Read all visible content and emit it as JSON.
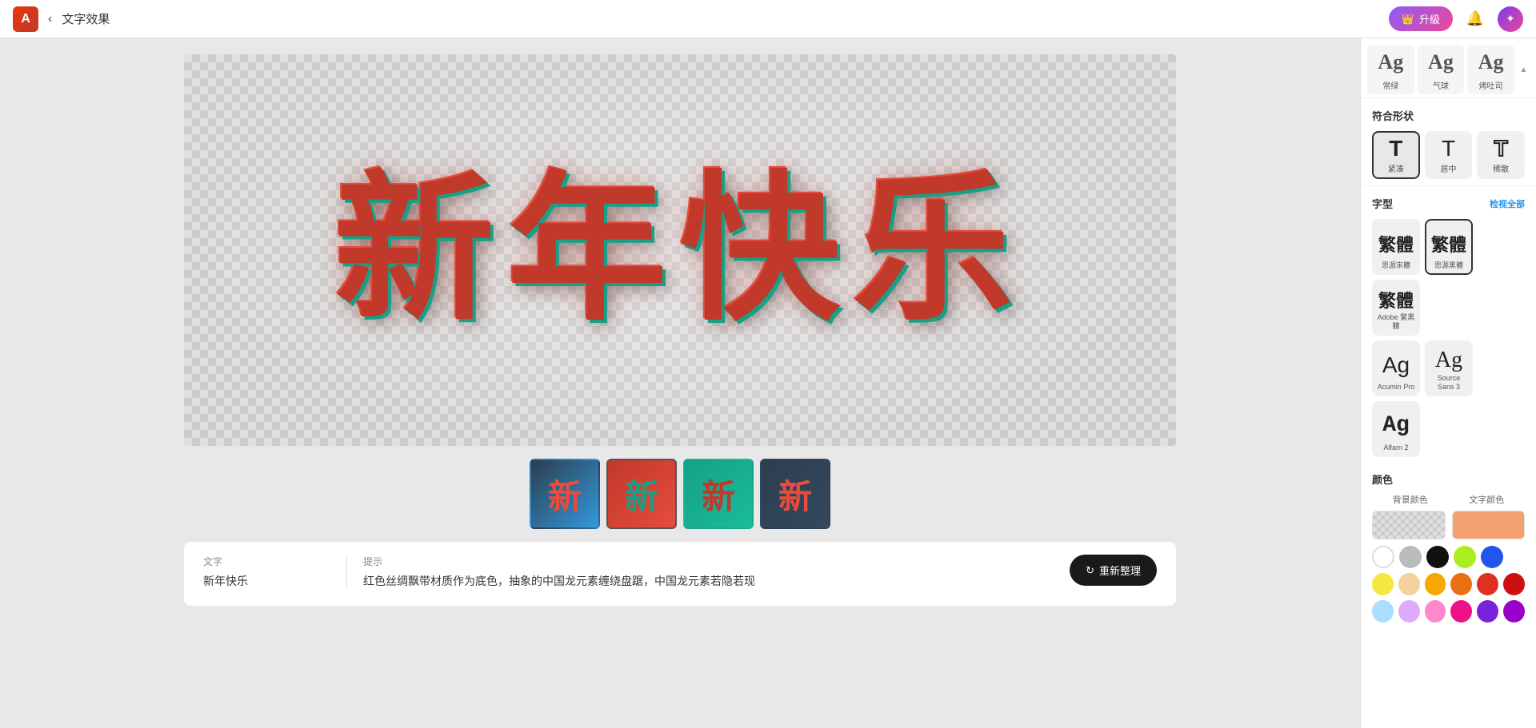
{
  "topbar": {
    "logo_letter": "A",
    "back_icon": "‹",
    "title": "文字效果",
    "upgrade_label": "升級",
    "notification_icon": "🔔",
    "avatar_icon": "🌐"
  },
  "canvas": {
    "art_text": "新年快乐",
    "thumbnails": [
      {
        "char": "新",
        "style": "thumb-1",
        "active": false
      },
      {
        "char": "新",
        "style": "thumb-2",
        "active": true
      },
      {
        "char": "新",
        "style": "thumb-3",
        "active": false
      },
      {
        "char": "新",
        "style": "thumb-4",
        "active": false
      }
    ]
  },
  "info": {
    "text_label": "文字",
    "text_value": "新年快乐",
    "prompt_label": "提示",
    "prompt_text": "红色丝绸飘带材质作为底色，抽象的中国龙元素缠绕盘踞，中国龙元素若隐若现",
    "regenerate_label": "重新整理",
    "regenerate_icon": "↻"
  },
  "sidebar": {
    "style_cards_top": [
      {
        "label": "常绿",
        "display": "Ag"
      },
      {
        "label": "气球",
        "display": "Ag"
      },
      {
        "label": "烤吐司",
        "display": "Ag"
      }
    ],
    "shape_section": {
      "title": "符合形状",
      "shapes": [
        {
          "label": "紧凑",
          "style": "bold",
          "active": true
        },
        {
          "label": "居中",
          "style": "normal",
          "active": false
        },
        {
          "label": "稀散",
          "style": "outline",
          "active": false
        }
      ]
    },
    "font_section": {
      "title": "字型",
      "view_all_label": "检视全部",
      "fonts_row1": [
        {
          "label": "思源宋體",
          "preview": "繁體",
          "active": false
        },
        {
          "label": "思源黑體",
          "preview": "繁體",
          "active": true
        },
        {
          "label": "Adobe 繁黑體",
          "preview": "繁體",
          "active": false
        }
      ],
      "fonts_row2": [
        {
          "label": "Acumin Pro",
          "preview": "Ag",
          "active": false
        },
        {
          "label": "Source Sans 3",
          "preview": "Ag",
          "active": false
        },
        {
          "label": "Alfarn 2",
          "preview": "Ag",
          "active": false
        }
      ]
    },
    "color_section": {
      "title": "颜色",
      "bg_label": "背景颜色",
      "text_label": "文字颜色",
      "swatches_row1": [
        "#ffffff",
        "#bbbbbb",
        "#111111",
        "#aaee22",
        "#2255ee"
      ],
      "swatches_row2": [
        "#f5e642",
        "#f5d0a0",
        "#f5a800",
        "#e87010",
        "#e03020",
        "#cc1010"
      ],
      "swatches_row3": [
        "#aaddff",
        "#ddaaff",
        "#ff88cc",
        "#ee1188",
        "#7722dd",
        "#9900cc"
      ]
    }
  }
}
